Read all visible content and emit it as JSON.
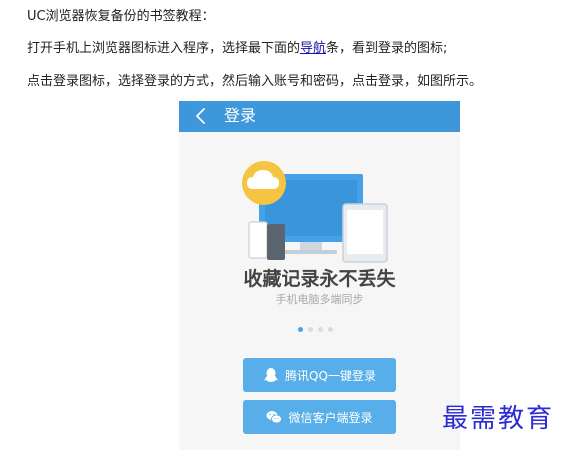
{
  "article": {
    "line1": "UC浏览器恢复备份的书签教程：",
    "line2_before": "打开手机上浏览器图标进入程序，选择最下面的",
    "line2_link": "导航",
    "line2_after": "条，看到登录的图标;",
    "line3": "点击登录图标，选择登录的方式，然后输入账号和密码，点击登录，如图所示。"
  },
  "phone": {
    "appbar": {
      "title": "登录",
      "back_icon": "chevron-left-icon",
      "color": "#3e97db"
    },
    "hero": {
      "title": "收藏记录永不丢失",
      "subtitle": "手机电脑多端同步",
      "illustration": "cloud-devices-icon"
    },
    "carousel": {
      "pages": 4,
      "active": 1
    },
    "buttons": {
      "qq": {
        "label": "腾讯QQ一键登录",
        "icon": "qq-penguin-icon"
      },
      "wechat": {
        "label": "微信客户端登录",
        "icon": "wechat-icon"
      }
    },
    "accent": "#57aee8"
  },
  "watermark": "最需教育"
}
